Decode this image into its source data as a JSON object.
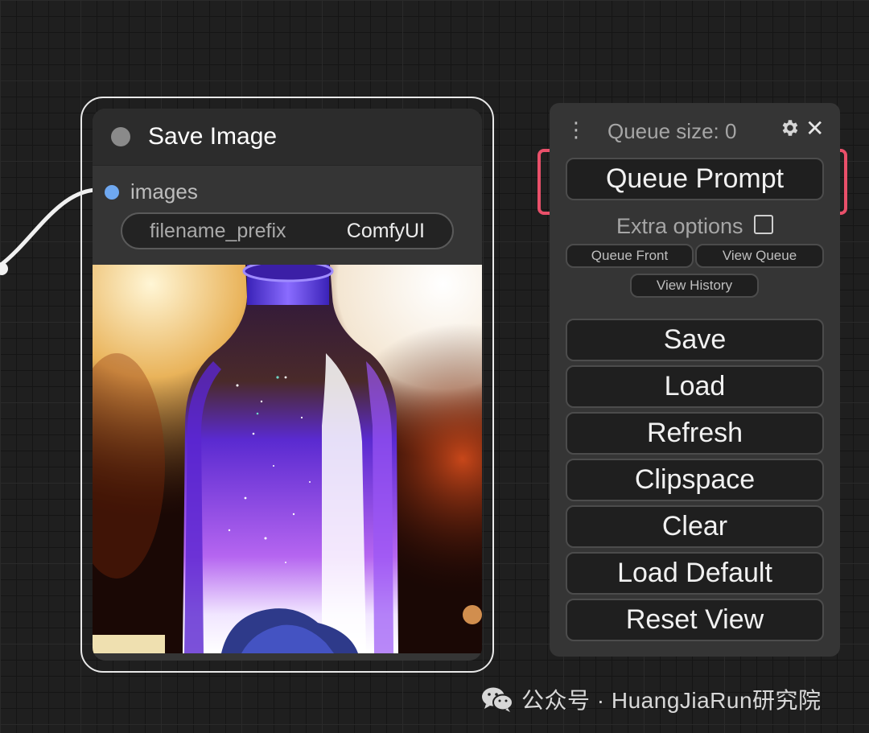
{
  "node": {
    "title": "Save Image",
    "input_slot": "images",
    "widget": {
      "label": "filename_prefix",
      "value": "ComfyUI"
    }
  },
  "menu": {
    "queue_size": "Queue size: 0",
    "queue_prompt": "Queue Prompt",
    "extra_options": "Extra options",
    "extra_options_checked": false,
    "queue_front": "Queue Front",
    "view_queue": "View Queue",
    "view_history": "View History",
    "buttons": {
      "save": "Save",
      "load": "Load",
      "refresh": "Refresh",
      "clipspace": "Clipspace",
      "clear": "Clear",
      "load_default": "Load Default",
      "reset_view": "Reset View"
    }
  },
  "watermark": {
    "text": "公众号 · HuangJiaRun研究院"
  },
  "colors": {
    "highlight": "#e9506a",
    "slot_blue": "#6fa8f0",
    "canvas_bg": "#1f1f1f"
  }
}
